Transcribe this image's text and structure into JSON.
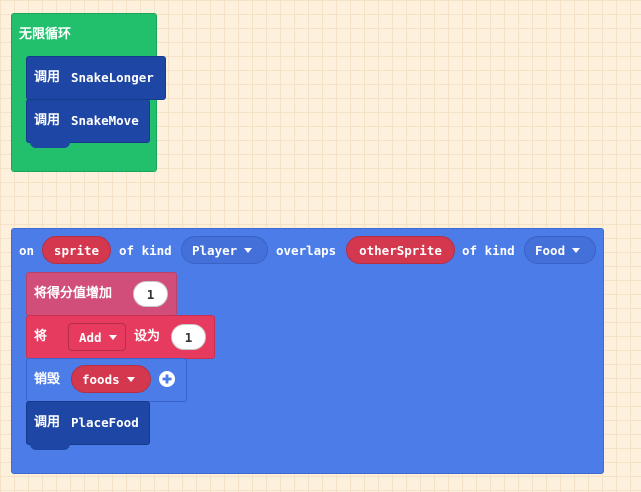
{
  "forever_block": {
    "label": "无限循环",
    "color": "#22c06d",
    "statements": [
      {
        "call_label": "调用",
        "function_name": "SnakeLonger"
      },
      {
        "call_label": "调用",
        "function_name": "SnakeMove"
      }
    ]
  },
  "overlap_event": {
    "color": "#4c7ce7",
    "on_label": "on",
    "sprite_var": "sprite",
    "of_kind_label_1": "of kind",
    "kind_1": "Player",
    "overlaps_label": "overlaps",
    "other_sprite_var": "otherSprite",
    "of_kind_label_2": "of kind",
    "kind_2": "Food",
    "score_block": {
      "label": "将得分值增加",
      "value": "1",
      "color": "#d14e7a"
    },
    "set_block": {
      "label": "将",
      "variable": "Add",
      "set_label": "设为",
      "value": "1",
      "color": "#e63b5e"
    },
    "destroy_block": {
      "label": "销毁",
      "variable": "foods",
      "color": "#4c7ce7"
    },
    "call_block": {
      "call_label": "调用",
      "function_name": "PlaceFood"
    }
  },
  "colors": {
    "function_call": "#1e46a4",
    "variable_reporter": "#d4384f",
    "canvas": "#fdf0dc"
  }
}
